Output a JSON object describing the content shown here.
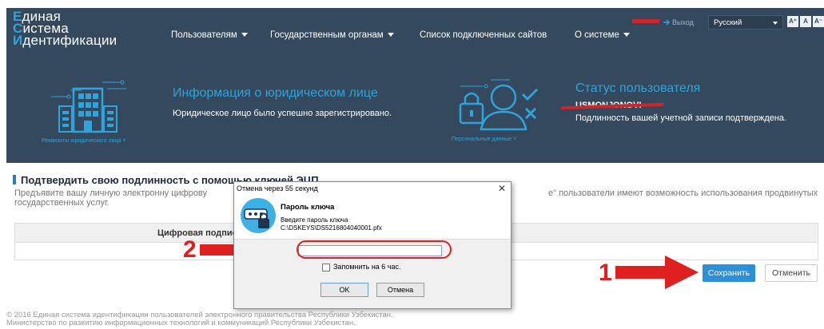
{
  "header": {
    "logo_lines": [
      {
        "initial": "Е",
        "rest": "диная"
      },
      {
        "initial": "С",
        "rest": "истема"
      },
      {
        "initial": "И",
        "rest": "дентификации"
      }
    ],
    "nav": [
      {
        "label": "Пользователям",
        "dropdown": true
      },
      {
        "label": "Государственным органам",
        "dropdown": true
      },
      {
        "label": "Список подключенных сайтов",
        "dropdown": false
      },
      {
        "label": "О системе",
        "dropdown": true
      }
    ],
    "exit_label": "Выход",
    "language": "Русский",
    "font_buttons": [
      "A⁺",
      "A",
      "A⁻"
    ],
    "brand_color": "#34495e",
    "accent_color": "#2ea3dc"
  },
  "banner": {
    "info_title": "Информация о юридическом лице",
    "info_text": "Юридическое лицо было успешно зарегистрировано.",
    "info_icon_caption": "Реквизиты юридического лица",
    "status_title": "Статус пользователя",
    "status_user": "USMONJONOVI",
    "status_text": "Подлинность вашей учетной записи подтверждена.",
    "status_icon_caption": "Персональные данные"
  },
  "content": {
    "section_title": "Подтвердить свою подлинность с помощью ключей ЭЦП",
    "desc_part1": "Предъявите вашу личную электронну цифрову",
    "desc_part2": "е\" пользователи имеют возможность использования продвинутых",
    "desc_part3": "государственных услуг.",
    "table_header": "Цифровая подпись",
    "save_label": "Сохранить",
    "cancel_label": "Отменить"
  },
  "dialog": {
    "title": "Отмена через 55 секунд",
    "heading": "Пароль ключа",
    "subtitle": "Введите пароль ключа",
    "path": "C:\\DSKEYS\\DS5216804040001.pfx",
    "password_value": "",
    "remember_label": "Запомнить на 6 час.",
    "ok_label": "OK",
    "cancel_label": "Отмена"
  },
  "annotations": {
    "step1": "1",
    "step2": "2",
    "color": "#e02020"
  },
  "footer": {
    "line1": "© 2016 Единая система идентификации пользователей электронного правительства Республики Узбекистан.",
    "line2": "Министерство по развитию информационных технологий и коммуникаций Республики Узбекистан."
  }
}
